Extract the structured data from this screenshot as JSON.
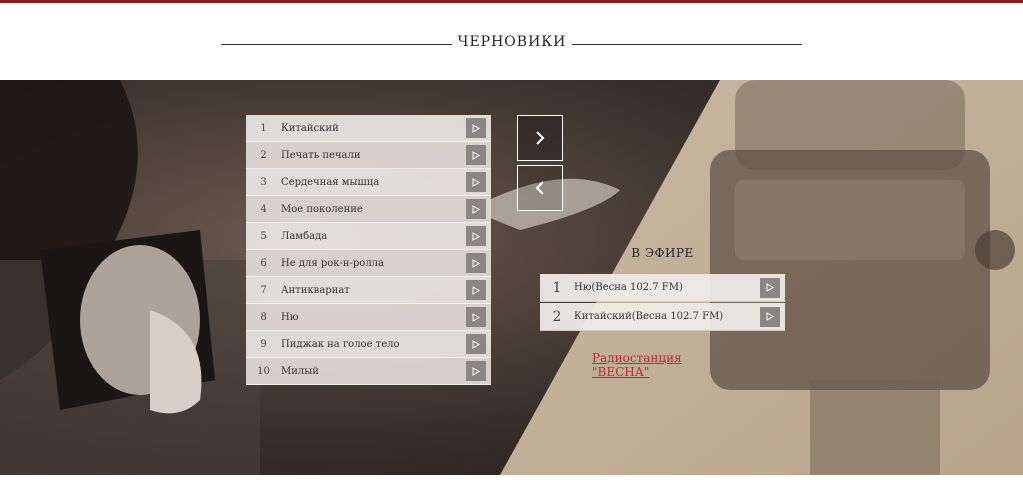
{
  "header": {
    "title": "ЧЕРНОВИКИ"
  },
  "colors": {
    "accent": "#8e1a1e",
    "link": "#c0282a",
    "play_button": "#8a8684"
  },
  "playlist": [
    {
      "num": "1",
      "title": "Китайский"
    },
    {
      "num": "2",
      "title": "Печать печали"
    },
    {
      "num": "3",
      "title": "Сердечная мышца"
    },
    {
      "num": "4",
      "title": "Мое поколение"
    },
    {
      "num": "5",
      "title": "Ламбада"
    },
    {
      "num": "6",
      "title": "Не для рок-н-ролла"
    },
    {
      "num": "7",
      "title": "Антиквариат"
    },
    {
      "num": "8",
      "title": "Ню"
    },
    {
      "num": "9",
      "title": "Пиджак на голое тело"
    },
    {
      "num": "10",
      "title": "Милый"
    }
  ],
  "navigation": {
    "next_icon": "chevron-right-icon",
    "prev_icon": "chevron-left-icon"
  },
  "on_air": {
    "title": "В ЭФИРЕ",
    "items": [
      {
        "num": "1",
        "title": "Ню(Весна 102.7 FM)"
      },
      {
        "num": "2",
        "title": "Китайский(Весна 102.7 FM)"
      }
    ]
  },
  "station_link": "Радиостанция \"ВЕСНА\""
}
